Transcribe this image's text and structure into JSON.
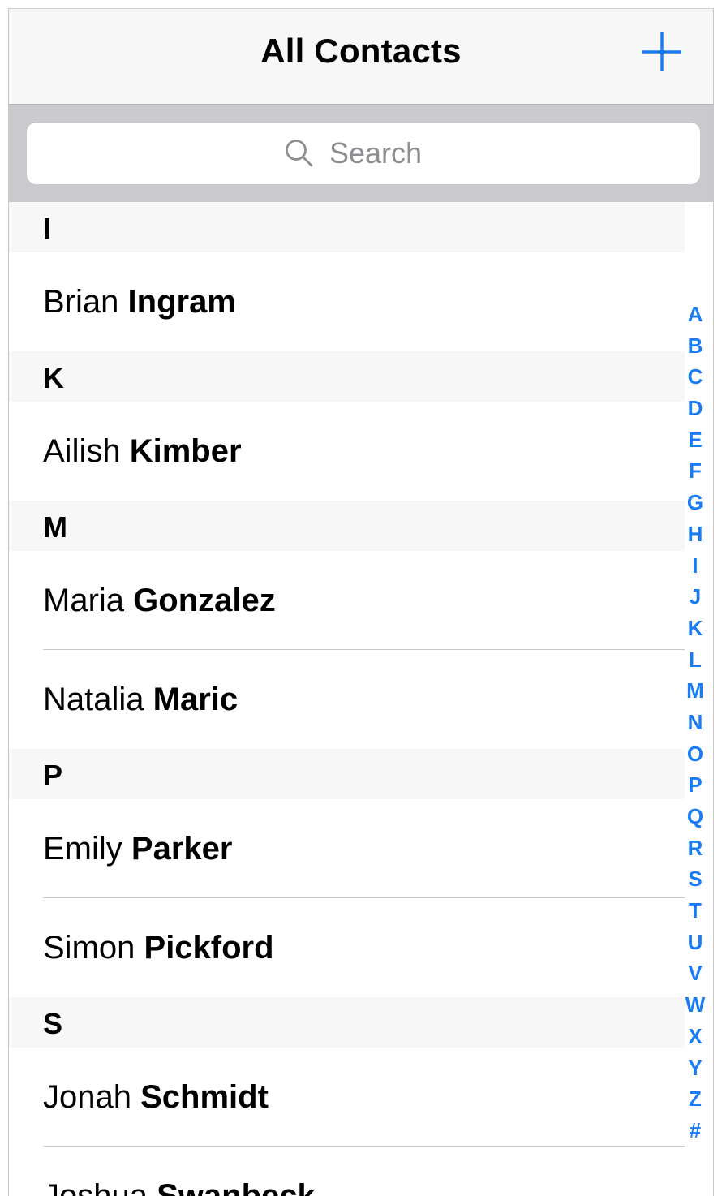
{
  "navbar": {
    "title": "All Contacts",
    "add_icon": "plus-icon",
    "accent_color": "#1a7cf5"
  },
  "search": {
    "placeholder": "Search",
    "icon": "search-icon"
  },
  "sections": [
    {
      "letter": "I",
      "contacts": [
        {
          "first": "Brian",
          "last": "Ingram"
        }
      ]
    },
    {
      "letter": "K",
      "contacts": [
        {
          "first": "Ailish",
          "last": "Kimber"
        }
      ]
    },
    {
      "letter": "M",
      "contacts": [
        {
          "first": "Maria",
          "last": "Gonzalez"
        },
        {
          "first": "Natalia",
          "last": "Maric"
        }
      ]
    },
    {
      "letter": "P",
      "contacts": [
        {
          "first": "Emily",
          "last": "Parker"
        },
        {
          "first": "Simon",
          "last": "Pickford"
        }
      ]
    },
    {
      "letter": "S",
      "contacts": [
        {
          "first": "Jonah",
          "last": "Schmidt"
        },
        {
          "first": "Joshua",
          "last": "Swanbeck"
        }
      ]
    }
  ],
  "index_letters": [
    "A",
    "B",
    "C",
    "D",
    "E",
    "F",
    "G",
    "H",
    "I",
    "J",
    "K",
    "L",
    "M",
    "N",
    "O",
    "P",
    "Q",
    "R",
    "S",
    "T",
    "U",
    "V",
    "W",
    "X",
    "Y",
    "Z",
    "#"
  ]
}
